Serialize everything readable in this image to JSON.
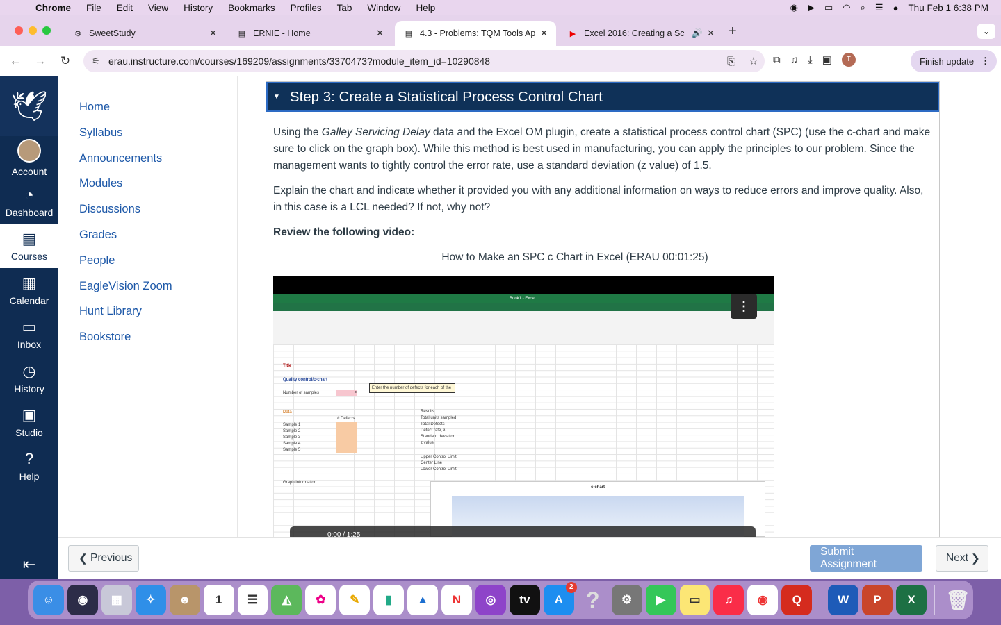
{
  "menubar": {
    "app": "Chrome",
    "items": [
      "File",
      "Edit",
      "View",
      "History",
      "Bookmarks",
      "Profiles",
      "Tab",
      "Window",
      "Help"
    ],
    "datetime": "Thu Feb 1  6:38 PM"
  },
  "tabs": [
    {
      "title": "SweetStudy",
      "active": false
    },
    {
      "title": "ERNIE - Home",
      "active": false
    },
    {
      "title": "4.3 - Problems: TQM Tools Ap",
      "active": true
    },
    {
      "title": "Excel 2016: Creating a Sc",
      "active": false
    }
  ],
  "toolbar": {
    "url": "erau.instructure.com/courses/169209/assignments/3370473?module_item_id=10290848",
    "finish_update": "Finish update",
    "profile_initial": "T"
  },
  "global_nav": {
    "items": [
      {
        "label": "Account",
        "icon": "account-avatar"
      },
      {
        "label": "Dashboard",
        "icon": "dashboard-icon"
      },
      {
        "label": "Courses",
        "icon": "courses-icon",
        "active": true
      },
      {
        "label": "Calendar",
        "icon": "calendar-icon"
      },
      {
        "label": "Inbox",
        "icon": "inbox-icon"
      },
      {
        "label": "History",
        "icon": "history-icon"
      },
      {
        "label": "Studio",
        "icon": "studio-icon"
      },
      {
        "label": "Help",
        "icon": "help-icon"
      }
    ]
  },
  "course_nav": {
    "items": [
      "Home",
      "Syllabus",
      "Announcements",
      "Modules",
      "Discussions",
      "Grades",
      "People",
      "EagleVision Zoom",
      "Hunt Library",
      "Bookstore"
    ]
  },
  "section": {
    "heading": "Step 3: Create a Statistical Process Control Chart",
    "p1_before": "Using the ",
    "p1_em": "Galley Servicing Delay",
    "p1_after": " data and the Excel OM plugin, create a statistical process control chart (SPC) (use the c-chart and make sure to click on the graph box). While this method is best used in manufacturing, you can apply the principles to our problem. Since the management wants to tightly control the error rate, use a standard deviation (z value) of 1.5.",
    "p2": "Explain the chart and indicate whether it provided you with any additional information on ways to reduce errors and improve quality. Also, in this case is a LCL needed? If not, why not?",
    "review": "Review the following video:",
    "video_title": "How to Make an SPC c Chart in Excel (ERAU 00:01:25)"
  },
  "video": {
    "excel_title": "Book1 - Excel",
    "sheet_title": "Title",
    "sheet_heading": "Quality control/c-chart",
    "num_samples_label": "Number of samples",
    "num_samples_value": "5",
    "hint": "Enter the number of defects for each of the",
    "data_label": "Data",
    "defects_header": "# Defects",
    "samples": [
      "Sample 1",
      "Sample 2",
      "Sample 3",
      "Sample 4",
      "Sample 5"
    ],
    "results_label": "Results",
    "results": [
      "Total units sampled",
      "Total Defects",
      "Defect rate, λ",
      "Standard deviation",
      "z value",
      "Upper Control Limit",
      "Center Line",
      "Lower Control Limit"
    ],
    "graph_info": "Graph information",
    "chart_title": "c-chart",
    "time": "0:00 / 1:25"
  },
  "footer": {
    "previous": "Previous",
    "submit": "Submit Assignment",
    "next": "Next"
  }
}
